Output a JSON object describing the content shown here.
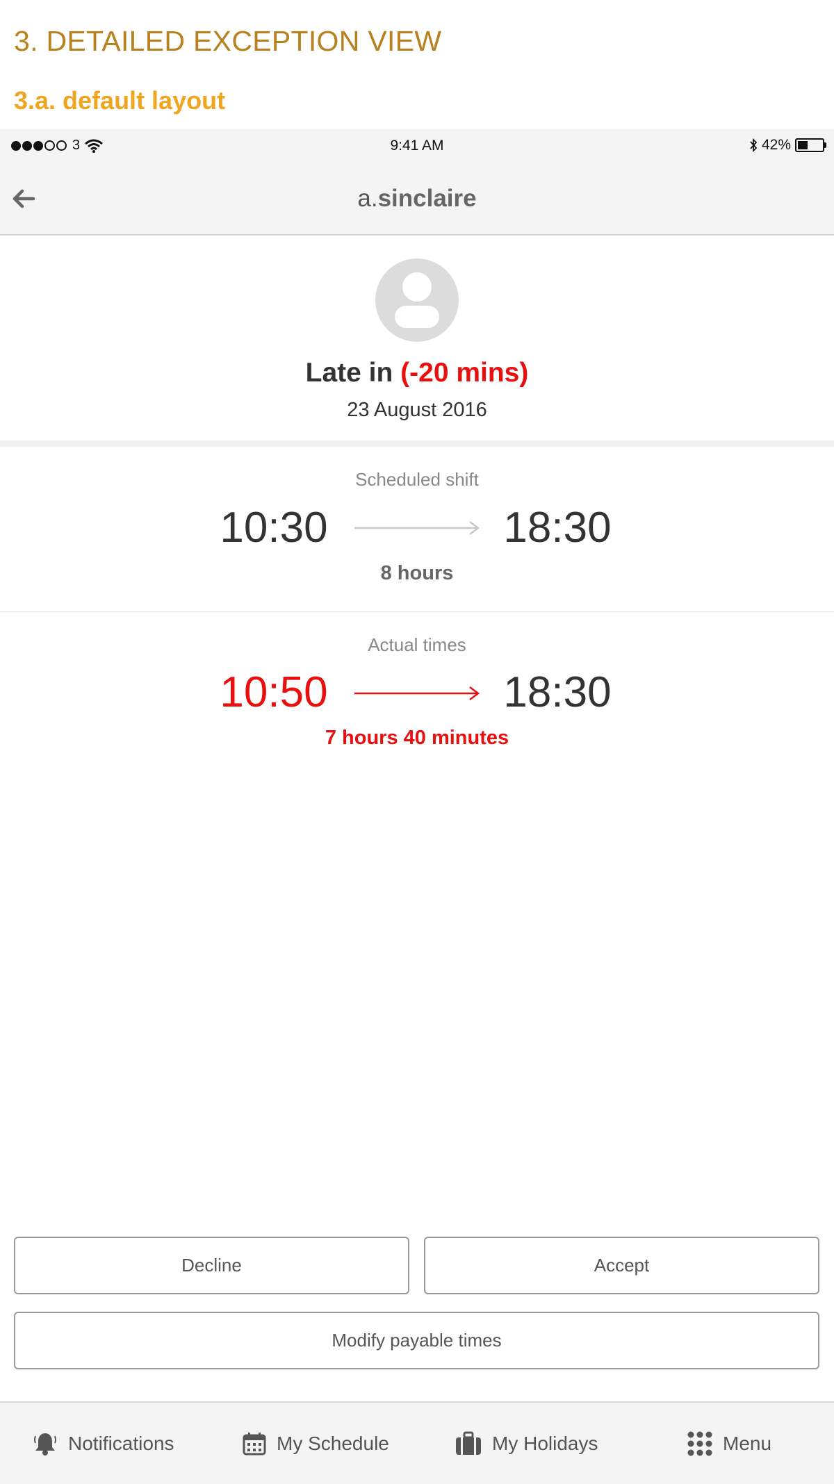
{
  "doc": {
    "heading": "3. DETAILED EXCEPTION VIEW",
    "subheading": "3.a. default layout"
  },
  "status_bar": {
    "carrier": "3",
    "signal_bars_filled": 3,
    "signal_bars_total": 5,
    "time": "9:41 AM",
    "battery_percent": "42%",
    "battery_level": 0.42
  },
  "nav": {
    "title_prefix": "a.",
    "title_brand": "sinclaire",
    "back_icon": "arrow-left-icon"
  },
  "exception": {
    "type_label": "Late in",
    "delta_label": "(-20 mins)",
    "date": "23 August 2016",
    "avatar_icon": "user-placeholder-icon"
  },
  "scheduled": {
    "label": "Scheduled shift",
    "start": "10:30",
    "end": "18:30",
    "duration": "8 hours"
  },
  "actual": {
    "label": "Actual times",
    "start": "10:50",
    "end": "18:30",
    "duration": "7 hours 40 minutes"
  },
  "actions": {
    "decline": "Decline",
    "accept": "Accept",
    "modify": "Modify payable times"
  },
  "tabs": [
    {
      "label": "Notifications",
      "icon": "bell-icon"
    },
    {
      "label": "My Schedule",
      "icon": "calendar-icon"
    },
    {
      "label": "My Holidays",
      "icon": "suitcase-icon"
    },
    {
      "label": "Menu",
      "icon": "grid-dots-icon"
    }
  ],
  "colors": {
    "doc_heading": "#b9801e",
    "doc_subheading": "#f0a521",
    "alert_red": "#e8100f",
    "bar_background": "#f4f4f4"
  }
}
